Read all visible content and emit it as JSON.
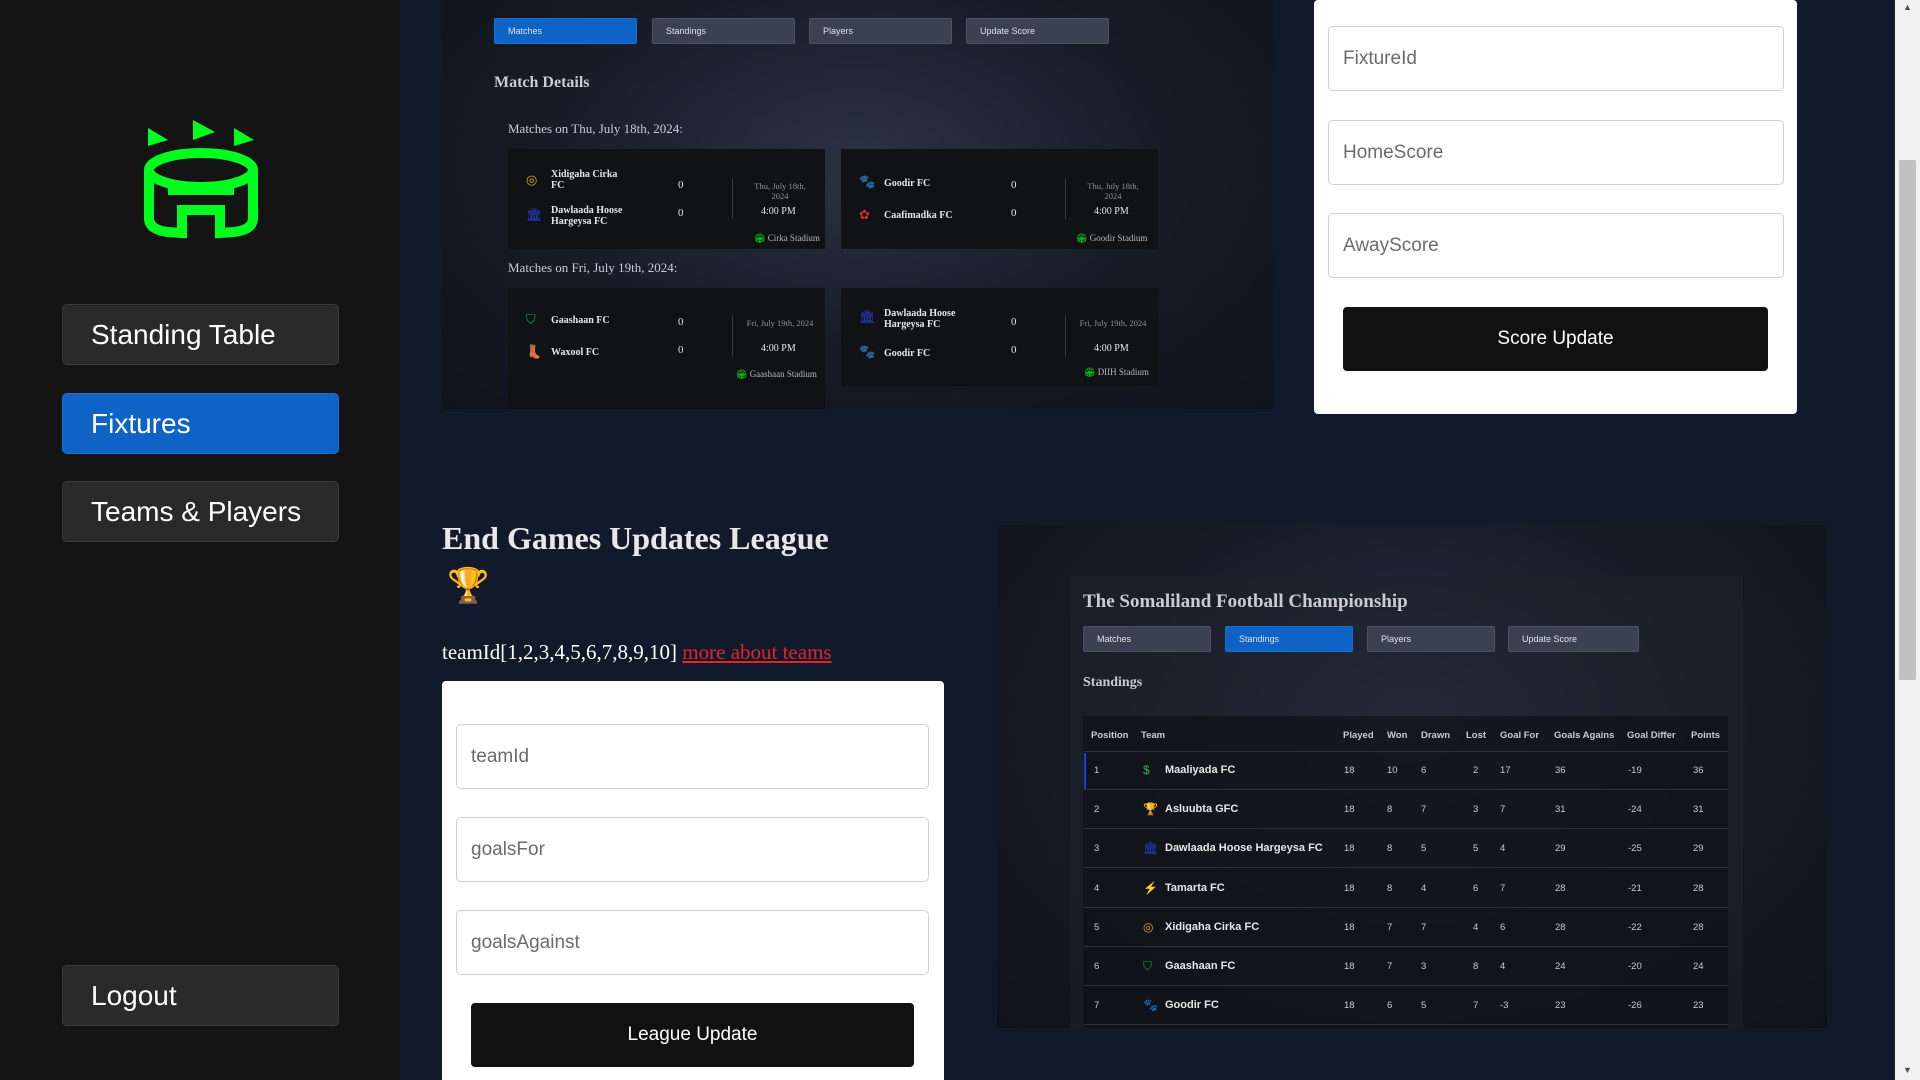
{
  "sidebar": {
    "nav": [
      "Standing Table",
      "Fixtures",
      "Teams & Players"
    ],
    "logout": "Logout"
  },
  "fixtures_preview": {
    "tabs": [
      "Matches",
      "Standings",
      "Players",
      "Update Score"
    ],
    "section_title": "Match Details",
    "days": [
      {
        "label": "Matches on Thu, July 18th, 2024:",
        "matches": [
          {
            "home": "Xidigaha Cirka FC",
            "away": "Dawlaada Hoose Hargeysa FC",
            "home_score": "0",
            "away_score": "0",
            "date": "Thu, July 18th, 2024",
            "time": "4:00 PM",
            "stadium": "Cirka Stadium",
            "home_icon": "ring-icon",
            "away_icon": "building-icon"
          },
          {
            "home": "Goodir FC",
            "away": "Caafimadka FC",
            "home_score": "0",
            "away_score": "0",
            "date": "Thu, July 18th, 2024",
            "time": "4:00 PM",
            "stadium": "Goodir Stadium",
            "home_icon": "paw-icon",
            "away_icon": "flower-icon"
          }
        ]
      },
      {
        "label": "Matches on Fri, July 19th, 2024:",
        "matches": [
          {
            "home": "Gaashaan FC",
            "away": "Waxool FC",
            "home_score": "0",
            "away_score": "0",
            "date": "Fri, July 19th, 2024",
            "time": "4:00 PM",
            "stadium": "Gaashaan Stadium",
            "home_icon": "shield-icon",
            "away_icon": "boot-icon"
          },
          {
            "home": "Dawlaada Hoose Hargeysa FC",
            "away": "Goodir FC",
            "home_score": "0",
            "away_score": "0",
            "date": "Fri, July 19th, 2024",
            "time": "4:00 PM",
            "stadium": "DIIH Stadium",
            "home_icon": "building-icon",
            "away_icon": "paw-icon"
          }
        ]
      }
    ]
  },
  "score_form": {
    "fixture_placeholder": "FixtureId",
    "home_placeholder": "HomeScore",
    "away_placeholder": "AwayScore",
    "button": "Score Update"
  },
  "league": {
    "title": "End Games Updates League",
    "trophy": "🏆",
    "teamid_text": "teamId[1,2,3,4,5,6,7,8,9,10]",
    "more_link": "more about teams",
    "team_placeholder": "teamId",
    "goals_for_placeholder": "goalsFor",
    "goals_against_placeholder": "goalsAgainst",
    "button": "League Update"
  },
  "standings_preview": {
    "title": "The Somaliland Football Championship",
    "tabs": [
      "Matches",
      "Standings",
      "Players",
      "Update Score"
    ],
    "section_title": "Standings",
    "columns": [
      "Position",
      "Team",
      "Played",
      "Won",
      "Drawn",
      "Lost",
      "Goal For",
      "Goals Agains",
      "Goal Differ",
      "Points"
    ],
    "rows": [
      [
        "1",
        "Maaliyada FC",
        "18",
        "10",
        "6",
        "2",
        "17",
        "36",
        "-19",
        "36"
      ],
      [
        "2",
        "Asluubta GFC",
        "18",
        "8",
        "7",
        "3",
        "7",
        "31",
        "-24",
        "31"
      ],
      [
        "3",
        "Dawlaada Hoose Hargeysa FC",
        "18",
        "8",
        "5",
        "5",
        "4",
        "29",
        "-25",
        "29"
      ],
      [
        "4",
        "Tamarta FC",
        "18",
        "8",
        "4",
        "6",
        "7",
        "28",
        "-21",
        "28"
      ],
      [
        "5",
        "Xidigaha Cirka FC",
        "18",
        "7",
        "7",
        "4",
        "6",
        "28",
        "-22",
        "28"
      ],
      [
        "6",
        "Gaashaan FC",
        "18",
        "7",
        "3",
        "8",
        "4",
        "24",
        "-20",
        "24"
      ],
      [
        "7",
        "Goodir FC",
        "18",
        "6",
        "5",
        "7",
        "-3",
        "23",
        "-26",
        "23"
      ]
    ],
    "row_icons": [
      "dollar-icon",
      "trophy-icon",
      "building-icon",
      "bolt-icon",
      "ring-icon",
      "shield-icon",
      "paw-icon"
    ]
  },
  "colors": {
    "brand_green": "#00ff1e",
    "active_blue": "#0f63c6",
    "link_red": "#e8222c",
    "page_bg": "#111a2b"
  }
}
